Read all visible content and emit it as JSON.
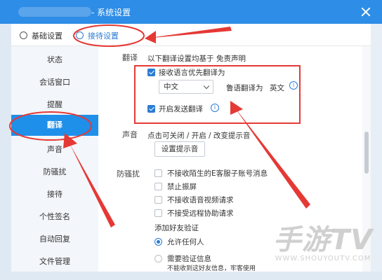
{
  "window": {
    "title": "- 系统设置"
  },
  "tabs": [
    {
      "label": "基础设置"
    },
    {
      "label": "接待设置"
    }
  ],
  "sidebar": {
    "items": [
      {
        "label": "状态"
      },
      {
        "label": "会话窗口"
      },
      {
        "label": "提醒"
      },
      {
        "label": "翻译",
        "active": true
      },
      {
        "label": "声音"
      },
      {
        "label": "防骚扰"
      },
      {
        "label": "接待"
      },
      {
        "label": "个性签名"
      },
      {
        "label": "自动回复"
      },
      {
        "label": "文件管理"
      }
    ]
  },
  "translate": {
    "section_label": "翻译",
    "note": "以下翻译设置均基于",
    "disclaimer_link": "免责声明",
    "auto_translate_label": "接收语言优先翻译为",
    "auto_translate_checked": true,
    "language_value": "中文",
    "common_translate_label": "鲁语翻译为",
    "common_translate_value": "英文",
    "send_translate_label": "开启发送翻译",
    "send_translate_checked": true
  },
  "sound": {
    "section_label": "声音",
    "description": "点击可关闭 / 开启 / 改变提示音",
    "button_label": "设置提示音"
  },
  "anti_harass": {
    "section_label": "防骚扰",
    "options": [
      {
        "label": "不接收陌生的E客服子账号消息",
        "checked": false
      },
      {
        "label": "禁止振屏",
        "checked": false
      },
      {
        "label": "不接收语音视频请求",
        "checked": false
      },
      {
        "label": "不接受远程协助请求",
        "checked": false
      }
    ],
    "friend_verify_label": "添加好友验证",
    "radio_options": [
      {
        "label": "允许任何人",
        "selected": true
      },
      {
        "label": "需要验证信息",
        "selected": false
      }
    ],
    "truncated_text": "不能收到这好友信息，牢客使用"
  },
  "annotation": {
    "color": "#e53935"
  },
  "watermark": {
    "logo": "手游TV",
    "url": "WWW.SHOUYOUTV.COM"
  }
}
